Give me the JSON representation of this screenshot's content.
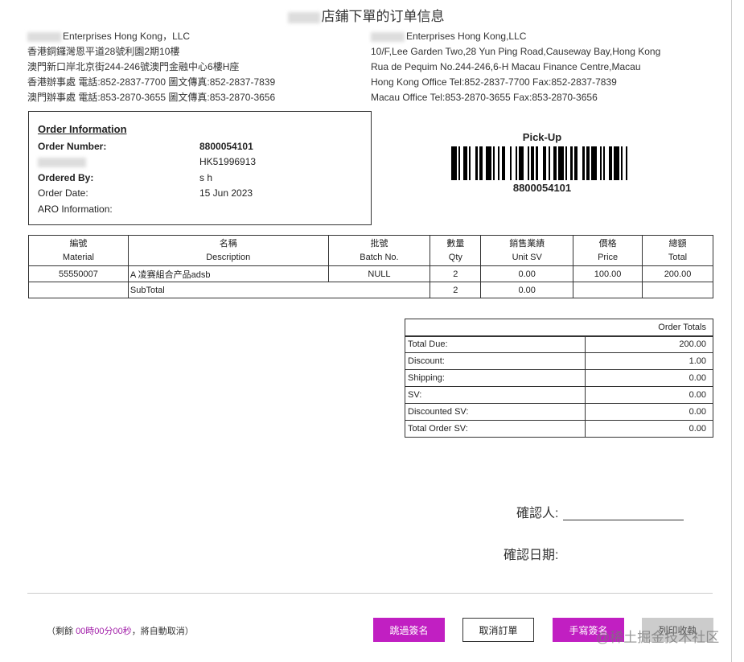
{
  "title": "店鋪下單的订单信息",
  "address_left": [
    "Enterprises Hong Kong，LLC",
    "香港銅鑼灣恩平道28號利園2期10樓",
    "澳門新口岸北京街244-246號澳門金融中心6樓H座",
    "香港辦事處 電話:852-2837-7700 圖文傳真:852-2837-7839",
    "澳門辦事處 電話:853-2870-3655 圖文傳真:853-2870-3656"
  ],
  "address_right": [
    "Enterprises Hong Kong,LLC",
    "10/F,Lee Garden Two,28 Yun Ping Road,Causeway Bay,Hong Kong",
    "Rua de Pequim No.244-246,6-H Macau Finance Centre,Macau",
    "Hong Kong Office Tel:852-2837-7700 Fax:852-2837-7839",
    "Macau Office Tel:853-2870-3655 Fax:853-2870-3656"
  ],
  "order_info": {
    "heading": "Order Information",
    "order_number_label": "Order Number:",
    "order_number": "8800054101",
    "member_id": "HK51996913",
    "ordered_by_label": "Ordered By:",
    "ordered_by": "s h",
    "order_date_label": "Order Date:",
    "order_date": "15 Jun 2023",
    "aro_label": "ARO Information:"
  },
  "pickup": {
    "label": "Pick-Up",
    "barcode_number": "8800054101"
  },
  "items_table": {
    "headers": [
      {
        "zh": "編號",
        "en": "Material"
      },
      {
        "zh": "名稱",
        "en": "Description"
      },
      {
        "zh": "批號",
        "en": "Batch No."
      },
      {
        "zh": "數量",
        "en": "Qty"
      },
      {
        "zh": "銷售業績",
        "en": "Unit SV"
      },
      {
        "zh": "價格",
        "en": "Price"
      },
      {
        "zh": "總額",
        "en": "Total"
      }
    ],
    "rows": [
      {
        "material": "55550007",
        "description": "A  凌赛組合产品adsb",
        "batch": "NULL",
        "qty": "2",
        "unit_sv": "0.00",
        "price": "100.00",
        "total": "200.00"
      }
    ],
    "subtotal": {
      "label": "SubTotal",
      "qty": "2",
      "unit_sv": "0.00"
    }
  },
  "order_totals": {
    "heading": "Order Totals",
    "rows": [
      {
        "label": "Total Due:",
        "value": "200.00"
      },
      {
        "label": "Discount:",
        "value": "1.00"
      },
      {
        "label": "Shipping:",
        "value": "0.00"
      },
      {
        "label": "SV:",
        "value": "0.00"
      },
      {
        "label": "Discounted SV:",
        "value": "0.00"
      },
      {
        "label": "Total Order SV:",
        "value": "0.00"
      }
    ]
  },
  "confirm": {
    "person_label": "確認人:",
    "date_label": "確認日期:"
  },
  "countdown": {
    "prefix": "（剩餘 ",
    "time": "00時00分00秒",
    "suffix": "，將自動取消）"
  },
  "buttons": {
    "skip_sign": "跳過簽名",
    "cancel_order": "取消訂單",
    "hand_sign": "手寫簽名",
    "print_receipt": "列印收執"
  },
  "watermark": "@稀土掘金技术社区",
  "colors": {
    "accent": "#c11fc2",
    "button_disabled": "#cccccc"
  }
}
